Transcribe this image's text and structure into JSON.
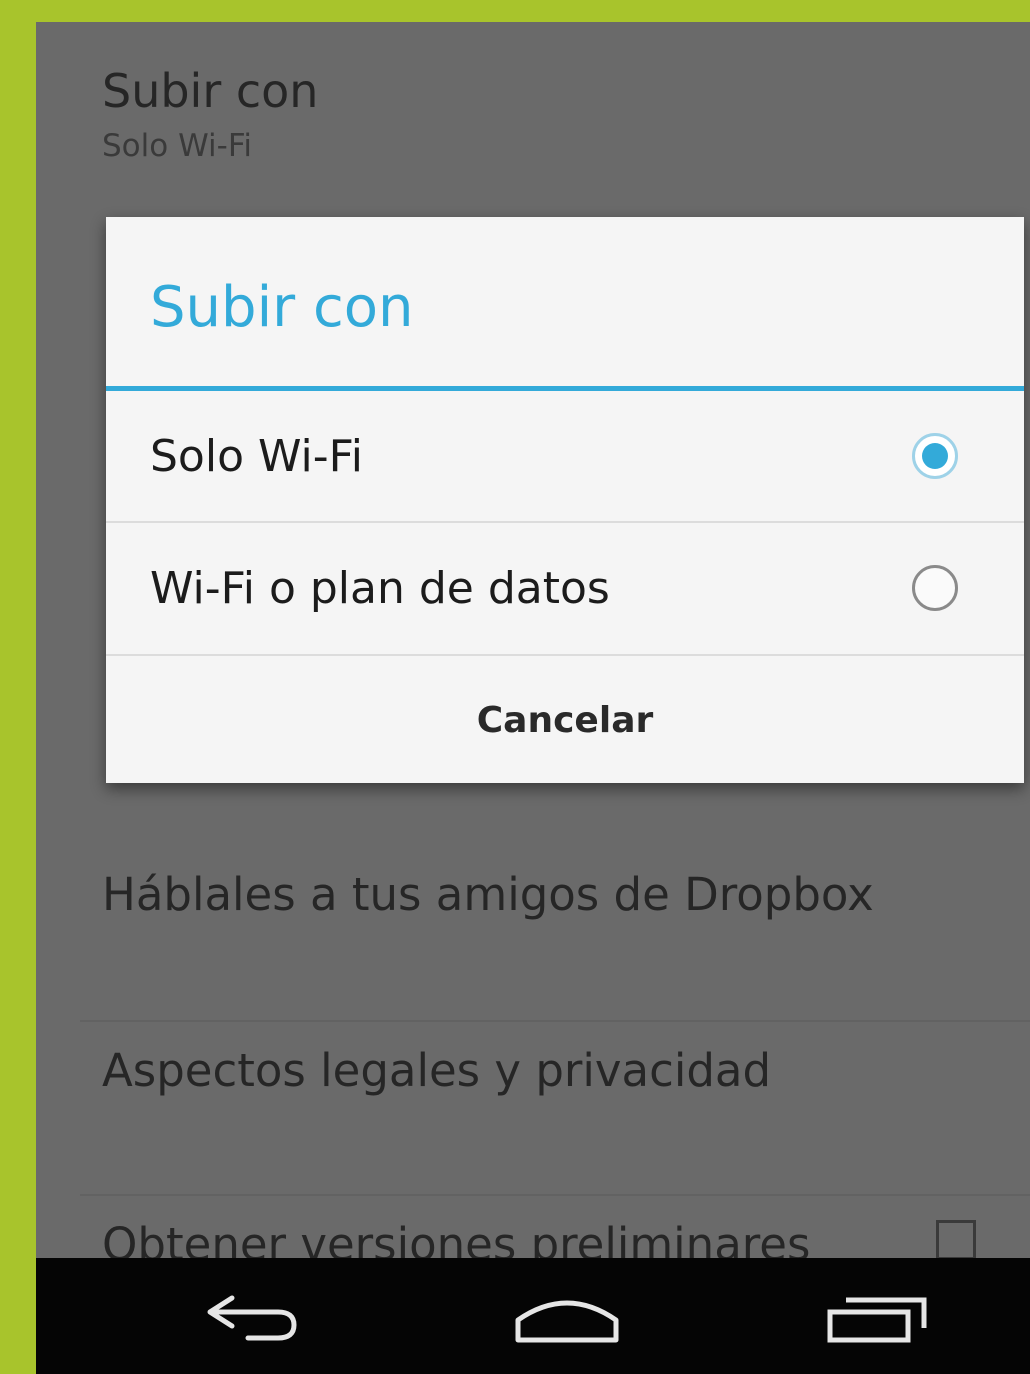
{
  "background_list": {
    "upload_title": "Subir con",
    "upload_value": "Solo Wi-Fi",
    "tell_friends": "Háblales a tus amigos de Dropbox",
    "legal": "Aspectos legales y privacidad",
    "early_versions": "Obtener versiones preliminares",
    "early_versions_checked": false
  },
  "dialog": {
    "title": "Subir con",
    "accent_color": "#33aad9",
    "options": [
      {
        "label": "Solo Wi-Fi",
        "selected": true
      },
      {
        "label": "Wi-Fi o plan de datos",
        "selected": false
      }
    ],
    "cancel_label": "Cancelar"
  },
  "nav_bar": {
    "icons": [
      "back-icon",
      "home-icon",
      "recent-apps-icon"
    ]
  },
  "colors": {
    "frame_border": "#a8c42c",
    "scrim": "#6a6a6a",
    "nav_bar": "#050505"
  }
}
